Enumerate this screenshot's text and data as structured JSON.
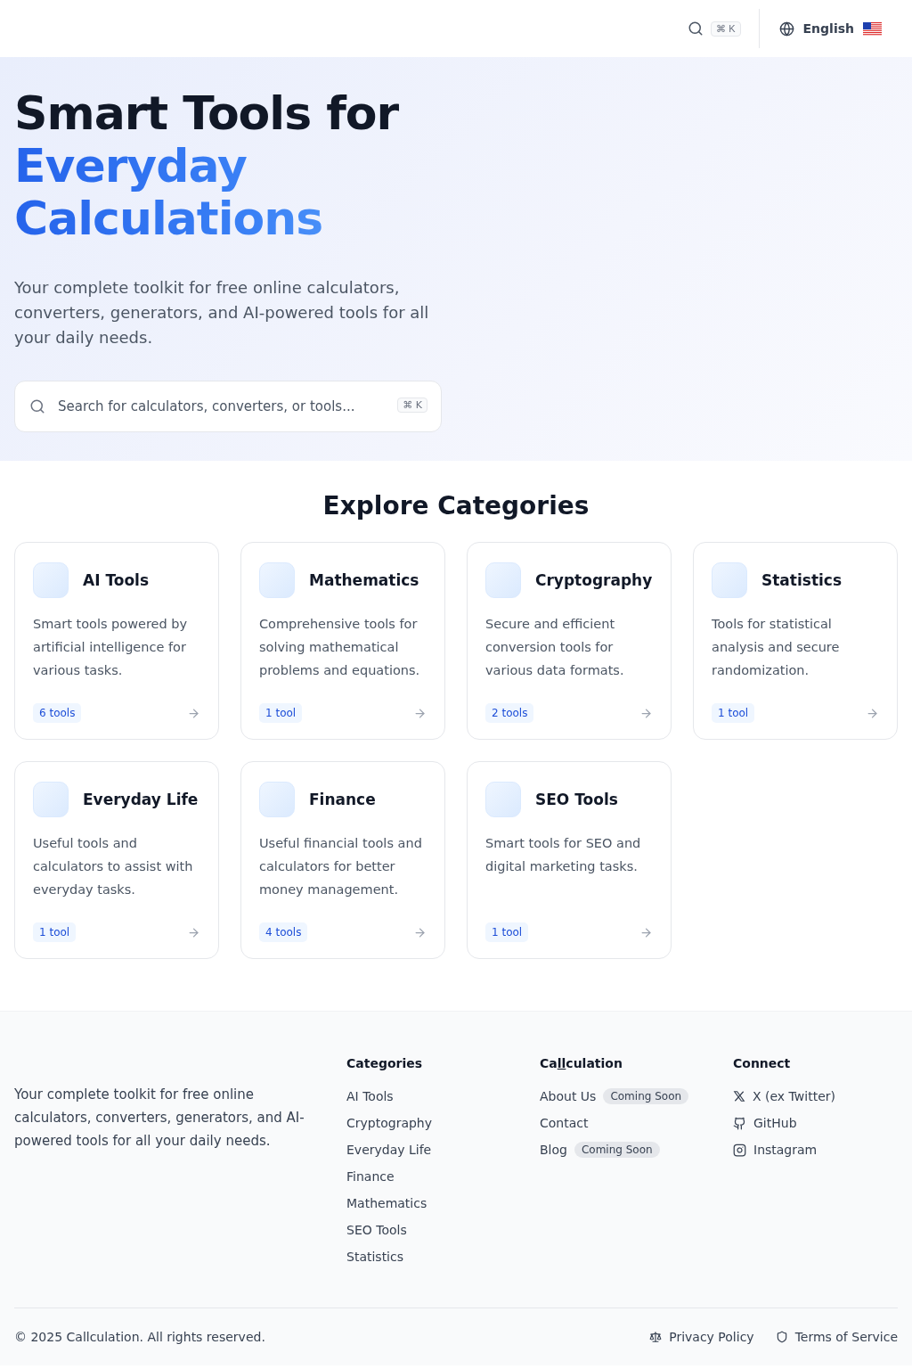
{
  "header": {
    "search_shortcut": "⌘ K",
    "language": "English"
  },
  "hero": {
    "title_line": "Smart Tools for",
    "title_highlight": "Everyday Calculations",
    "subtitle": "Your complete toolkit for free online calculators, converters, generators, and AI-powered tools for all your daily needs.",
    "search": {
      "placeholder": "Search for calculators, converters, or tools...",
      "shortcut": "⌘ K"
    }
  },
  "categories": {
    "title": "Explore Categories",
    "items": [
      {
        "name": "AI Tools",
        "description": "Smart tools powered by artificial intelligence for various tasks.",
        "count": "6 tools"
      },
      {
        "name": "Mathematics",
        "description": "Comprehensive tools for solving mathematical problems and equations.",
        "count": "1 tool"
      },
      {
        "name": "Cryptography",
        "description": "Secure and efficient conversion tools for various data formats.",
        "count": "2 tools"
      },
      {
        "name": "Statistics",
        "description": "Tools for statistical analysis and secure randomization.",
        "count": "1 tool"
      },
      {
        "name": "Everyday Life",
        "description": "Useful tools and calculators to assist with everyday tasks.",
        "count": "1 tool"
      },
      {
        "name": "Finance",
        "description": "Useful financial tools and calculators for better money management.",
        "count": "4 tools"
      },
      {
        "name": "SEO Tools",
        "description": "Smart tools for SEO and digital marketing tasks.",
        "count": "1 tool"
      }
    ]
  },
  "footer": {
    "tagline": "Your complete toolkit for free online calculators, converters, generators, and AI-powered tools for all your daily needs.",
    "columns": [
      {
        "title_parts": [
          {
            "text": "Categories",
            "underlined": false
          }
        ],
        "links": [
          {
            "label": "AI Tools"
          },
          {
            "label": "Cryptography"
          },
          {
            "label": "Everyday Life"
          },
          {
            "label": "Finance"
          },
          {
            "label": "Mathematics"
          },
          {
            "label": "SEO Tools"
          },
          {
            "label": "Statistics"
          }
        ]
      },
      {
        "title_parts": [
          {
            "text": "Ca",
            "underlined": false
          },
          {
            "text": "ll",
            "underlined": true
          },
          {
            "text": "culation",
            "underlined": false
          }
        ],
        "links": [
          {
            "label": "About Us",
            "badge": "Coming Soon"
          },
          {
            "label": "Contact"
          },
          {
            "label": "Blog",
            "badge": "Coming Soon"
          }
        ]
      },
      {
        "title_parts": [
          {
            "text": "Connect",
            "underlined": false
          }
        ],
        "links": [
          {
            "label": "X (ex Twitter)",
            "kind": "x"
          },
          {
            "label": "GitHub",
            "kind": "github"
          },
          {
            "label": "Instagram",
            "kind": "instagram"
          }
        ]
      }
    ],
    "copyright": "© 2025 Callculation. All rights reserved.",
    "legal": [
      {
        "label": "Privacy Policy",
        "kind": "scale"
      },
      {
        "label": "Terms of Service",
        "kind": "shield"
      }
    ]
  }
}
